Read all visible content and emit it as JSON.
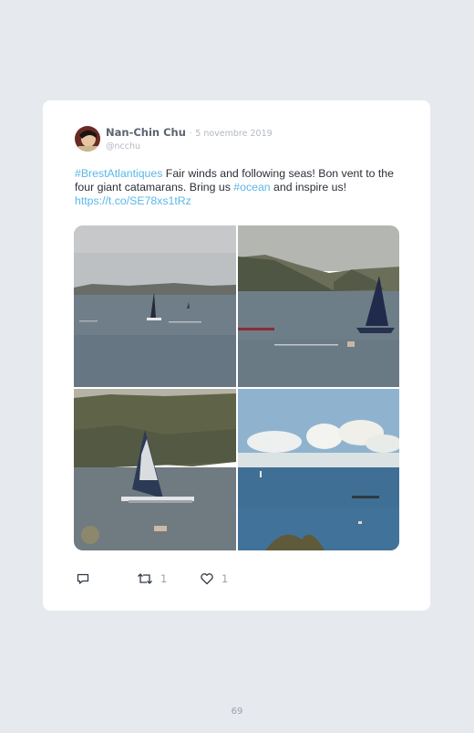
{
  "tweet": {
    "author_name": "Nan-Chin Chu",
    "separator": "·",
    "date": "5 novembre 2019",
    "handle": "@ncchu",
    "text_parts": {
      "hashtag1": "#BrestAtlantiques",
      "body1": " Fair winds and following seas! Bon vent to the four giant catamarans. Bring us ",
      "hashtag2": "#ocean",
      "body2": " and inspire us! ",
      "link": "https://t.co/SE78xs1tRz"
    },
    "reply_count": "",
    "retweet_count": "1",
    "like_count": "1"
  },
  "icons": {
    "reply": "reply-icon",
    "retweet": "retweet-icon",
    "like": "heart-icon"
  },
  "colors": {
    "link": "#59b8e8",
    "background": "#e6e9ee",
    "card": "#ffffff"
  },
  "footer": {
    "page_number": "69"
  }
}
